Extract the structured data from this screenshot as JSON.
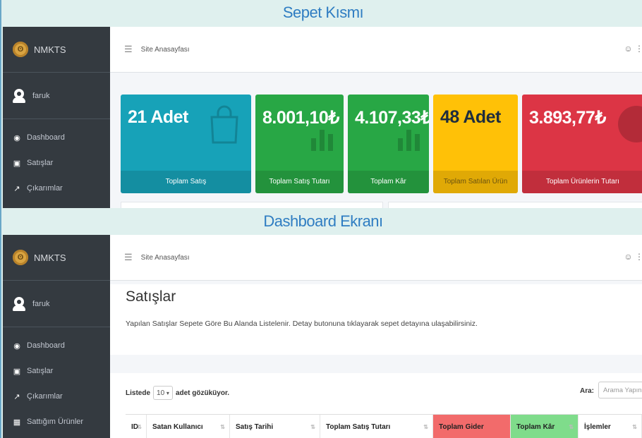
{
  "banners": {
    "top": "Sepet Kısmı",
    "middle": "Dashboard Ekranı"
  },
  "brand": {
    "name": "NMKTS"
  },
  "user": {
    "name": "faruk"
  },
  "nav": [
    {
      "label": "Dashboard",
      "icon": "dashboard-icon"
    },
    {
      "label": "Satışlar",
      "icon": "gift-icon"
    },
    {
      "label": "Çıkarımlar",
      "icon": "chart-line-icon"
    },
    {
      "label": "Sattığım Ürünler",
      "icon": "store-icon"
    }
  ],
  "topbar": {
    "home_link": "Site Anasayfası"
  },
  "stat_boxes": [
    {
      "value": "21 Adet",
      "label": "Toplam Satış",
      "color": "#17a2b8"
    },
    {
      "value": "8.001,10₺",
      "label": "Toplam Satış Tutarı",
      "color": "#28a745"
    },
    {
      "value": "4.107,33₺",
      "label": "Toplam Kâr",
      "color": "#28a745"
    },
    {
      "value": "48 Adet",
      "label": "Toplam Satılan Ürün",
      "color": "#ffc107"
    },
    {
      "value": "3.893,77₺",
      "label": "Toplam Ürünlerin Tutarı",
      "color": "#dc3545"
    }
  ],
  "sales_page": {
    "title": "Satışlar",
    "description": "Yapılan Satışlar Sepete Göre Bu Alanda Listelenir. Detay butonuna tıklayarak sepet detayına ulaşabilirsiniz.",
    "length_prefix": "Listede",
    "length_value": "10",
    "length_suffix": "adet gözüküyor.",
    "search_label": "Ara:",
    "search_placeholder": "Arama Yapın",
    "columns": [
      {
        "label": "ID"
      },
      {
        "label": "Satan Kullanıcı"
      },
      {
        "label": "Satış Tarihi"
      },
      {
        "label": "Toplam Satış Tutarı"
      },
      {
        "label": "Toplam Gider",
        "bg": "#f26b6b"
      },
      {
        "label": "Toplam Kâr",
        "bg": "#7fdc8b"
      },
      {
        "label": "İşlemler"
      }
    ]
  }
}
